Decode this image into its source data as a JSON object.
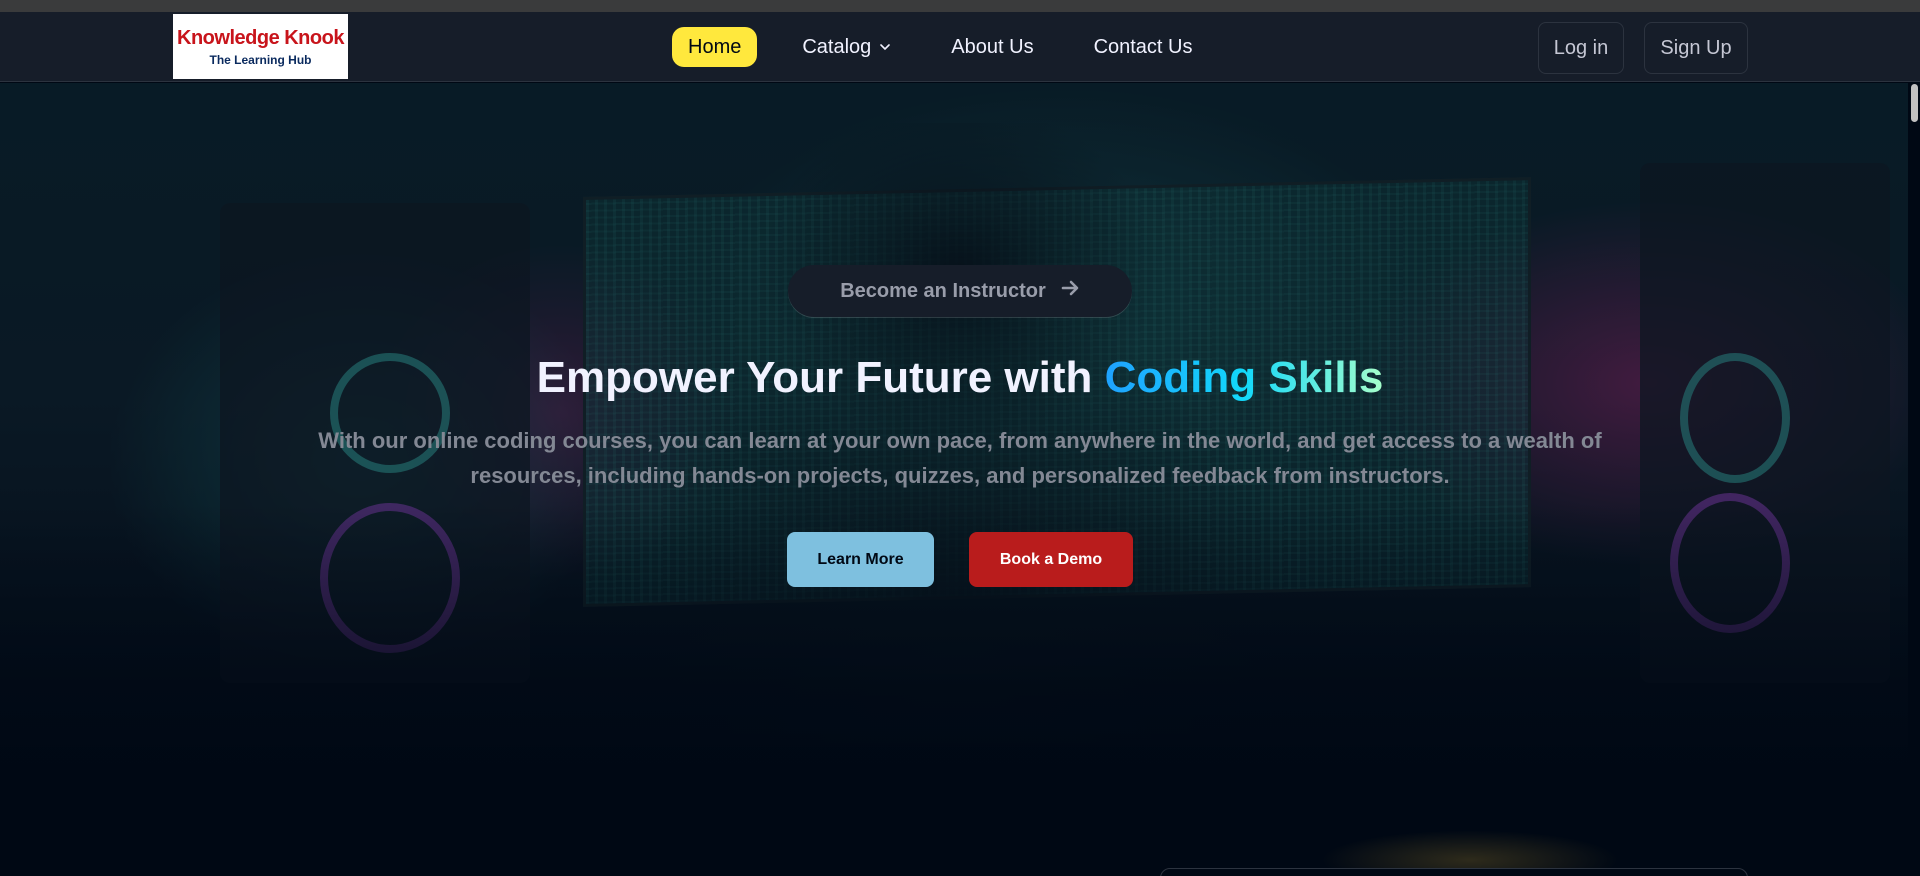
{
  "brand": {
    "name": "Knowledge Knook",
    "tagline": "The Learning Hub"
  },
  "nav": {
    "items": [
      {
        "label": "Home",
        "active": true
      },
      {
        "label": "Catalog",
        "has_dropdown": true
      },
      {
        "label": "About Us"
      },
      {
        "label": "Contact Us"
      }
    ]
  },
  "auth": {
    "login_label": "Log in",
    "signup_label": "Sign Up"
  },
  "hero": {
    "badge_label": "Become an Instructor",
    "headline_plain": "Empower Your Future with ",
    "headline_highlight": "Coding Skills",
    "subtext": "With our online coding courses, you can learn at your own pace, from anywhere in the world, and get access to a wealth of resources, including hands-on projects, quizzes, and personalized feedback from instructors.",
    "primary_cta": "Learn More",
    "secondary_cta": "Book a Demo"
  },
  "colors": {
    "accent_yellow": "#ffe83d",
    "nav_bg": "#161d29",
    "page_bg": "#000814",
    "learn_more_bg": "#7ec0df",
    "book_demo_bg": "#b91c1c",
    "brand_red": "#c8141b",
    "brand_blue": "#0a2a5e"
  },
  "icons": {
    "badge_arrow": "arrow-right-icon",
    "catalog_chevron": "chevron-down-icon"
  }
}
